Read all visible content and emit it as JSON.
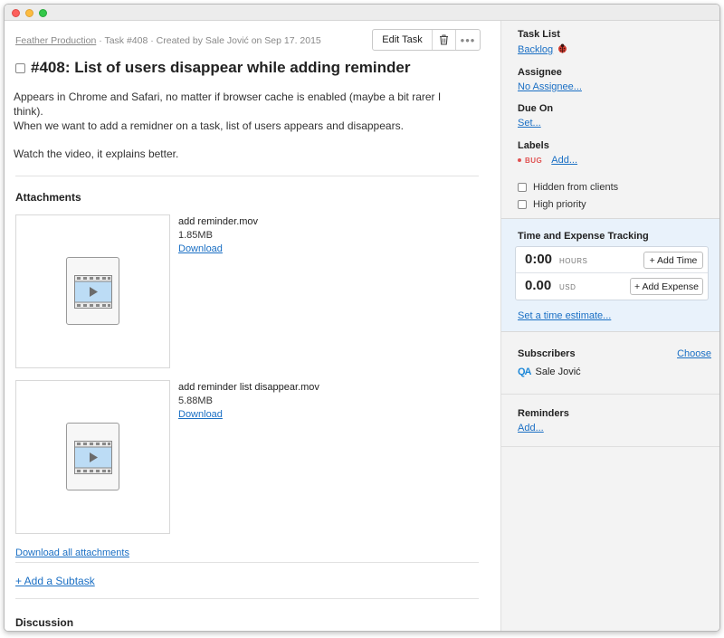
{
  "breadcrumb": {
    "project": "Feather Production",
    "rest": " · Task #408 · Created by Sale Jović on Sep 17. 2015"
  },
  "toolbar": {
    "edit_label": "Edit Task",
    "more_label": "•••"
  },
  "task": {
    "title": "#408: List of users disappear while adding reminder",
    "description": [
      "Appears in Chrome and Safari, no matter if browser cache is enabled (maybe a bit rarer I think).",
      "When we want to add a remidner on a task, list of users appears and disappears.",
      "Watch the video, it explains better."
    ]
  },
  "attachments": {
    "heading": "Attachments",
    "items": [
      {
        "name": "add reminder.mov",
        "size": "1.85MB",
        "action": "Download",
        "icon": "video-file-icon"
      },
      {
        "name": "add reminder list disappear.mov",
        "size": "5.88MB",
        "action": "Download",
        "icon": "video-file-icon"
      }
    ],
    "download_all": "Download all attachments"
  },
  "subtask": {
    "add_label": "+ Add a Subtask"
  },
  "discussion": {
    "heading": "Discussion"
  },
  "sidebar": {
    "task_list": {
      "label": "Task List",
      "value": "Backlog",
      "icon": "ladybug-icon"
    },
    "assignee": {
      "label": "Assignee",
      "value": "No Assignee..."
    },
    "due_on": {
      "label": "Due On",
      "value": "Set..."
    },
    "labels": {
      "label": "Labels",
      "tag": "BUG",
      "add": "Add...",
      "tag_color": "#e05252"
    },
    "hidden_from_clients": "Hidden from clients",
    "high_priority": "High priority",
    "time_expense": {
      "label": "Time and Expense Tracking",
      "hours_value": "0:00",
      "hours_unit": "HOURS",
      "add_time": "+ Add Time",
      "usd_value": "0.00",
      "usd_unit": "USD",
      "add_expense": "+ Add Expense",
      "estimate": "Set a time estimate..."
    },
    "subscribers": {
      "label": "Subscribers",
      "choose": "Choose",
      "user": "Sale Jović",
      "avatar": "QA"
    },
    "reminders": {
      "label": "Reminders",
      "add": "Add..."
    }
  },
  "colors": {
    "link": "#1a6fc4",
    "tracking_bg": "#e9f2fb",
    "sidebar_bg": "#f3f3f3"
  }
}
